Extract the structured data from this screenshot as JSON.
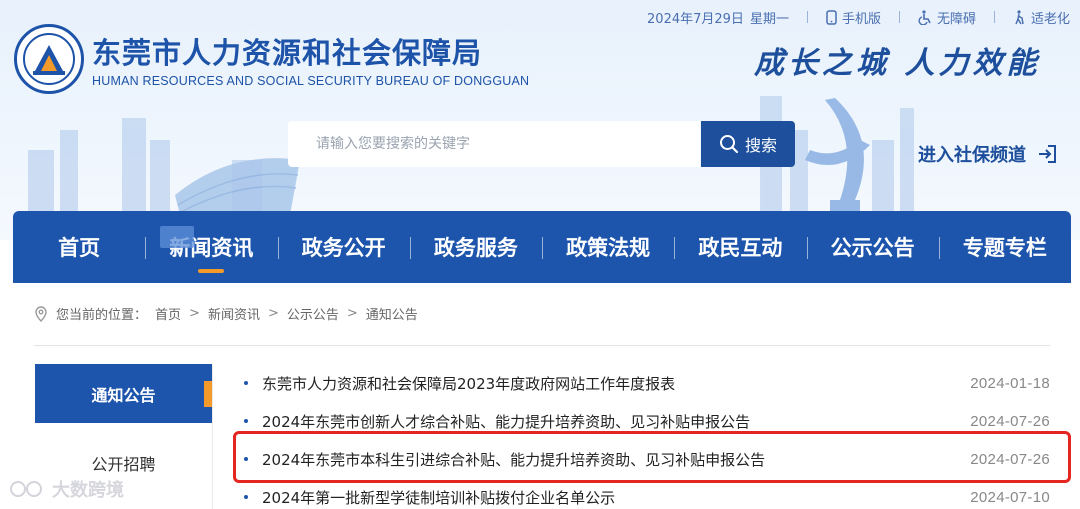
{
  "topbar": {
    "date": "2024年7月29日",
    "weekday": "星期一",
    "mobile": "手机版",
    "accessible": "无障碍",
    "elderly": "适老化"
  },
  "logo": {
    "cn": "东莞市人力资源和社会保障局",
    "en": "HUMAN RESOURCES AND SOCIAL SECURITY BUREAU OF DONGGUAN"
  },
  "slogan": "成长之城  人力效能",
  "search": {
    "placeholder": "请输入您要搜索的关键字",
    "button": "搜索"
  },
  "shebao_link": "进入社保频道",
  "nav": {
    "items": [
      "首页",
      "新闻资讯",
      "政务公开",
      "政务服务",
      "政策法规",
      "政民互动",
      "公示公告",
      "专题专栏"
    ],
    "active": "新闻资讯"
  },
  "breadcrumb": {
    "label": "您当前的位置：",
    "crumbs": [
      "首页",
      "新闻资讯",
      "公示公告",
      "通知公告"
    ]
  },
  "sidebar": {
    "active": "通知公告",
    "items": [
      "公开招聘"
    ]
  },
  "articles": [
    {
      "title": "东莞市人力资源和社会保障局2023年度政府网站工作年度报表",
      "date": "2024-01-18"
    },
    {
      "title": "2024年东莞市创新人才综合补贴、能力提升培养资助、见习补贴申报公告",
      "date": "2024-07-26"
    },
    {
      "title": "2024年东莞市本科生引进综合补贴、能力提升培养资助、见习补贴申报公告",
      "date": "2024-07-26"
    },
    {
      "title": "2024年第一批新型学徒制培训补贴拨付企业名单公示",
      "date": "2024-07-10"
    }
  ],
  "watermark": "大数跨境",
  "colors": {
    "brand_blue": "#1d55ad",
    "accent_orange": "#f39a2b",
    "highlight_red": "#e5251f"
  }
}
